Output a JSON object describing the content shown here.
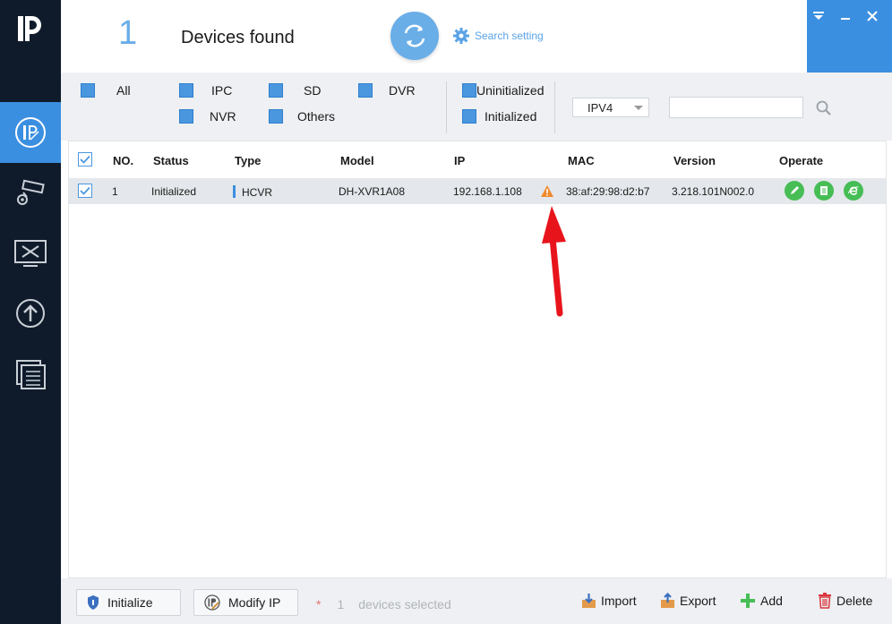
{
  "header": {
    "device_count": "1",
    "devices_found_label": "Devices found",
    "search_setting_label": "Search setting"
  },
  "filters": {
    "all": "All",
    "ipc": "IPC",
    "sd": "SD",
    "dvr": "DVR",
    "nvr": "NVR",
    "others": "Others",
    "uninitialized": "Uninitialized",
    "initialized": "Initialized",
    "ip_version": "IPV4",
    "search_value": ""
  },
  "table": {
    "columns": [
      "NO.",
      "Status",
      "Type",
      "Model",
      "IP",
      "MAC",
      "Version",
      "Operate"
    ],
    "rows": [
      {
        "no": "1",
        "status": "Initialized",
        "type": "HCVR",
        "model": "DH-XVR1A08",
        "ip": "192.168.1.108",
        "mac": "38:af:29:98:d2:b7",
        "version": "3.218.101N002.0"
      }
    ]
  },
  "footer": {
    "initialize_label": "Initialize",
    "modify_ip_label": "Modify IP",
    "star": "*",
    "selected_count": "1",
    "selected_label": "devices selected",
    "import_label": "Import",
    "export_label": "Export",
    "add_label": "Add",
    "delete_label": "Delete"
  },
  "colors": {
    "accent": "#3b8fe0",
    "sidebar": "#0f1b2a",
    "warning": "#f08a2c",
    "op_green": "#46bd55",
    "annotation_arrow": "#e8141c"
  }
}
